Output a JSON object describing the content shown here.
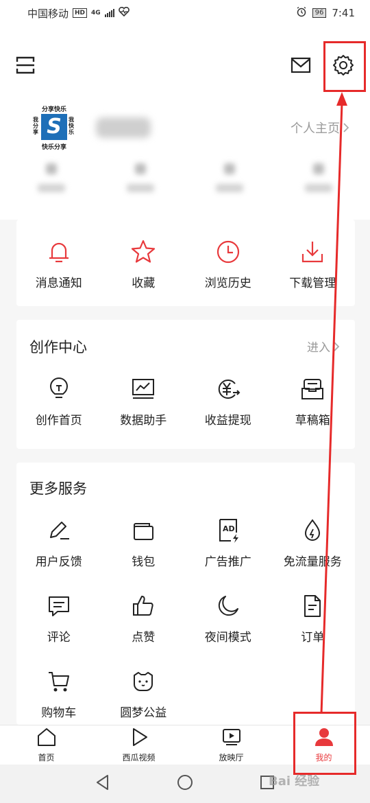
{
  "status_bar": {
    "carrier": "中国移动",
    "hd": "HD",
    "network": "4G",
    "battery": "96",
    "time": "7:41"
  },
  "profile": {
    "homepage_link": "个人主页"
  },
  "logo_text": {
    "top": "分享快乐",
    "bottom": "快乐分享",
    "left": "我分享",
    "right": "我快乐"
  },
  "quick_actions": [
    {
      "label": "消息通知",
      "icon": "bell-icon"
    },
    {
      "label": "收藏",
      "icon": "star-icon"
    },
    {
      "label": "浏览历史",
      "icon": "clock-icon"
    },
    {
      "label": "下载管理",
      "icon": "download-icon"
    }
  ],
  "creator_center": {
    "title": "创作中心",
    "enter": "进入",
    "items": [
      {
        "label": "创作首页",
        "icon": "lightbulb-icon"
      },
      {
        "label": "数据助手",
        "icon": "chart-monitor-icon"
      },
      {
        "label": "收益提现",
        "icon": "yuan-withdraw-icon"
      },
      {
        "label": "草稿箱",
        "icon": "draft-box-icon"
      }
    ]
  },
  "more_services": {
    "title": "更多服务",
    "items": [
      {
        "label": "用户反馈",
        "icon": "pen-icon"
      },
      {
        "label": "钱包",
        "icon": "wallet-icon"
      },
      {
        "label": "广告推广",
        "icon": "ad-icon"
      },
      {
        "label": "免流量服务",
        "icon": "drop-icon"
      },
      {
        "label": "评论",
        "icon": "comment-icon"
      },
      {
        "label": "点赞",
        "icon": "thumb-up-icon"
      },
      {
        "label": "夜间模式",
        "icon": "moon-icon"
      },
      {
        "label": "订单",
        "icon": "order-icon"
      },
      {
        "label": "购物车",
        "icon": "cart-icon"
      },
      {
        "label": "圆梦公益",
        "icon": "charity-cat-icon"
      }
    ]
  },
  "tabs": [
    {
      "label": "首页",
      "icon": "home-icon"
    },
    {
      "label": "西瓜视频",
      "icon": "play-icon"
    },
    {
      "label": "放映厅",
      "icon": "screen-play-icon"
    },
    {
      "label": "我的",
      "icon": "person-icon",
      "active": true
    }
  ],
  "watermark": "Bai 经验",
  "colors": {
    "accent": "#e8393c",
    "annotation": "#e62a2a"
  }
}
